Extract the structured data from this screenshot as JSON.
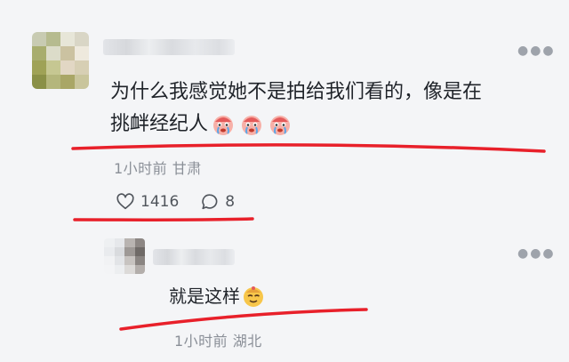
{
  "comment": {
    "author_blurred": true,
    "text_line1": "为什么我感觉她不是拍给我们看的，像是在",
    "text_line2": "挑衅经纪人",
    "emojis": [
      "crying-face-emoji",
      "crying-face-emoji",
      "crying-face-emoji"
    ],
    "time": "1小时前",
    "location": "甘肃",
    "likes": "1416",
    "replies": "8",
    "more_icon": "ellipsis-icon",
    "like_icon": "heart-outline-icon",
    "reply_icon": "speech-bubble-icon"
  },
  "reply": {
    "author_blurred": true,
    "text": "就是这样",
    "emoji": "smirk-face-emoji",
    "time": "1小时前",
    "location": "湖北",
    "more_icon": "ellipsis-icon"
  },
  "annotation_color": "#e8202a"
}
